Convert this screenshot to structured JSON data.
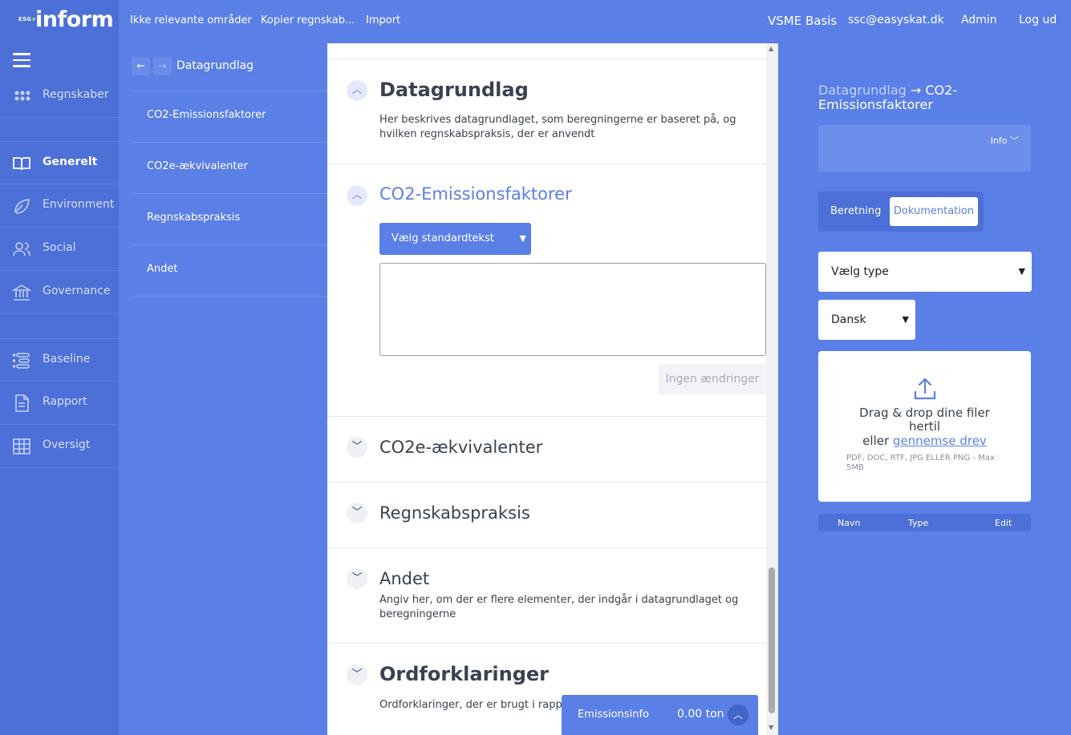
{
  "app": {
    "logo_prefix": "ESG",
    "logo_word": "inform"
  },
  "topnav": {
    "items": [
      "Ikke relevante områder",
      "Kopier regnskab...",
      "Import"
    ],
    "plan": "VSME Basis",
    "email": "ssc@easyskat.dk",
    "admin": "Admin",
    "logout": "Log ud"
  },
  "sidebar": {
    "items": [
      {
        "label": "Regnskaber",
        "icon": "grid-dots-icon"
      },
      {
        "label": "Generelt",
        "icon": "book-icon"
      },
      {
        "label": "Environment",
        "icon": "leaf-icon"
      },
      {
        "label": "Social",
        "icon": "users-icon"
      },
      {
        "label": "Governance",
        "icon": "bank-icon"
      },
      {
        "label": "Baseline",
        "icon": "list-icon"
      },
      {
        "label": "Rapport",
        "icon": "document-icon"
      },
      {
        "label": "Oversigt",
        "icon": "table-icon"
      }
    ]
  },
  "subnav": {
    "title": "Datagrundlag",
    "back": "←",
    "forward": "→",
    "items": [
      "CO2-Emissionsfaktorer",
      "CO2e-ækvivalenter",
      "Regnskabspraksis",
      "Andet"
    ]
  },
  "main": {
    "sections": [
      {
        "title": "Datagrundlag",
        "desc": "Her beskrives datagrundlaget, som beregningerne er baseret på, og hvilken regnskabspraksis, der er anvendt"
      },
      {
        "title": "CO2-Emissionsfaktorer",
        "select": "Vælg standardtekst",
        "textarea": "",
        "button": "Ingen ændringer"
      },
      {
        "title": "CO2e-ækvivalenter"
      },
      {
        "title": "Regnskabspraksis"
      },
      {
        "title": "Andet",
        "desc": "Angiv her, om der er flere elementer, der indgår i datagrundlaget og beregningerne"
      },
      {
        "title": "Ordforklaringer",
        "desc": "Ordforklaringer, der er brugt i rappo"
      }
    ]
  },
  "emission": {
    "label": "Emissionsinfo",
    "value": "0.00 ton"
  },
  "right": {
    "breadcrumb_parent": "Datagrundlag",
    "breadcrumb_arrow": "→",
    "breadcrumb_current": "CO2-Emissionsfaktorer",
    "info": "Info",
    "tabs": [
      "Beretning",
      "Dokumentation"
    ],
    "type_select": "Vælg type",
    "lang_select": "Dansk",
    "drop_title": "Drag & drop dine filer hertil",
    "drop_or": "eller",
    "drop_link": "gennemse drev",
    "drop_formats": "PDF, DOC, RTF, JPG ELLER PNG - Max 5MB",
    "table_headers": [
      "Navn",
      "Type",
      "Edit"
    ]
  },
  "colors": {
    "primary": "#5a7fe6",
    "sidebar": "#4c6fd8",
    "text": "#3a4150"
  }
}
